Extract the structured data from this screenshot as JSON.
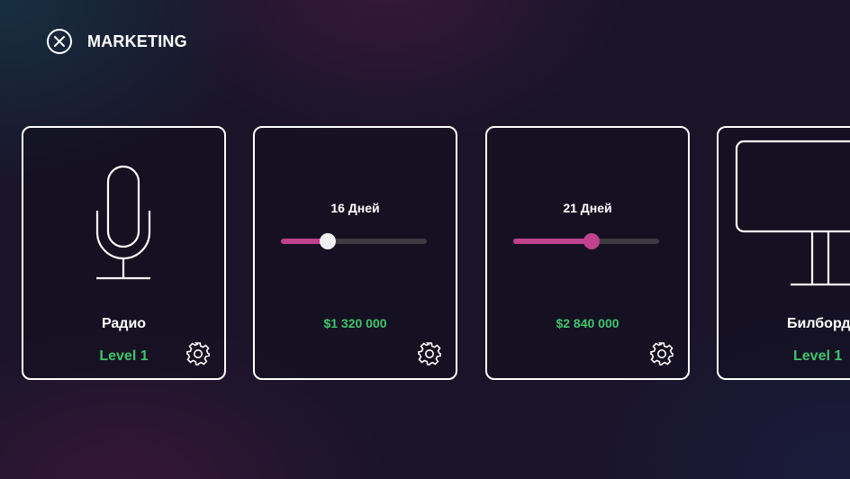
{
  "header": {
    "close_icon": "close-circle-icon",
    "title": "MARKETING"
  },
  "colors": {
    "accent_pink": "#c0418d",
    "price_green": "#3ec46d",
    "track": "#3c3a40",
    "thumb_white": "#f0f0f0"
  },
  "cards": [
    {
      "type": "channel",
      "icon": "microphone-icon",
      "name": "Радио",
      "level": "Level 1",
      "settings_icon": "gear-icon"
    },
    {
      "type": "duration",
      "days_label": "16 Дней",
      "slider_value": 0.32,
      "thumb_color": "#f0f0f0",
      "price": "$1 320 000",
      "settings_icon": "gear-icon"
    },
    {
      "type": "duration",
      "days_label": "21 Дней",
      "slider_value": 0.54,
      "thumb_color": "#c0418d",
      "price": "$2 840 000",
      "settings_icon": "gear-icon"
    },
    {
      "type": "channel",
      "icon": "billboard-icon",
      "name": "Билборд",
      "level": "Level 1",
      "settings_icon": "gear-icon"
    }
  ]
}
